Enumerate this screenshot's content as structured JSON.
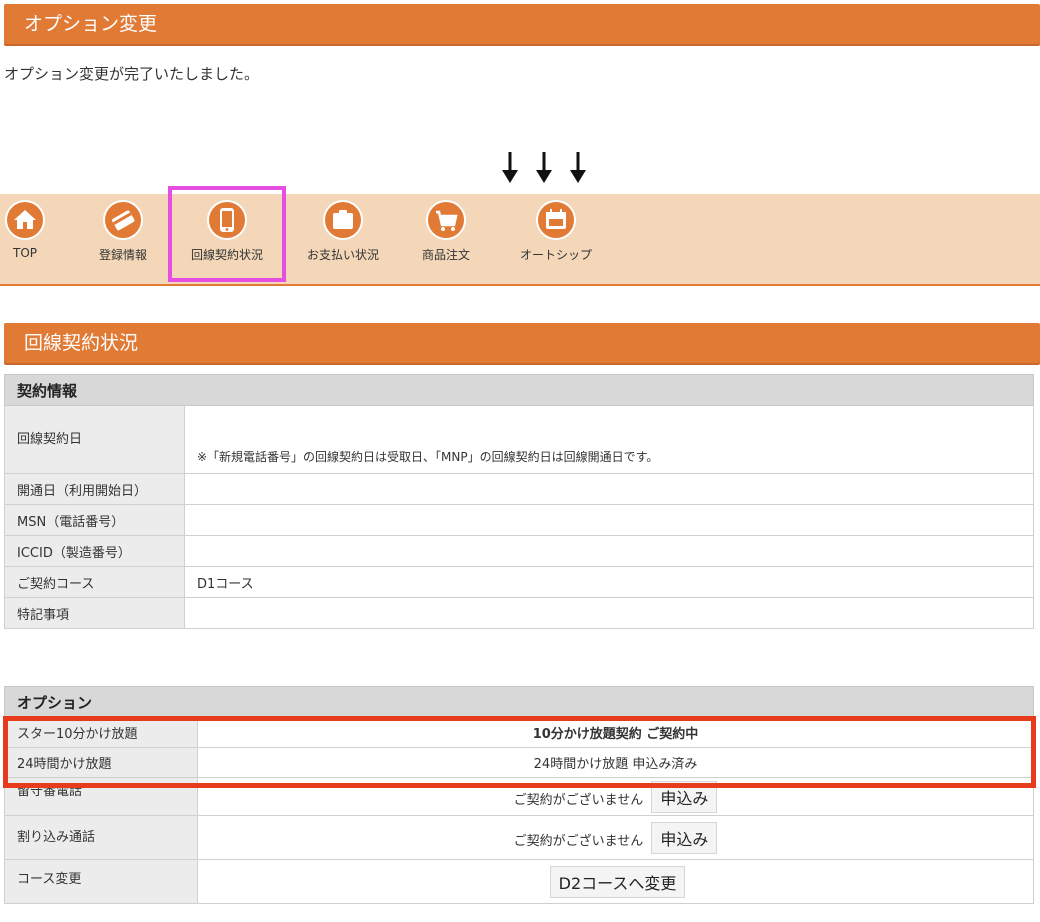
{
  "header": {
    "title": "オプション変更"
  },
  "message": "オプション変更が完了いたしました。",
  "nav": {
    "items": [
      {
        "label": "TOP",
        "icon": "home-icon"
      },
      {
        "label": "登録情報",
        "icon": "card-icon"
      },
      {
        "label": "回線契約状況",
        "icon": "smartphone-icon"
      },
      {
        "label": "お支払い状況",
        "icon": "wallet-icon"
      },
      {
        "label": "商品注文",
        "icon": "cart-icon"
      },
      {
        "label": "オートシップ",
        "icon": "calendar-icon"
      }
    ],
    "highlighted": "回線契約状況"
  },
  "line_section": {
    "title": "回線契約状況"
  },
  "contract": {
    "title": "契約情報",
    "rows": [
      {
        "label": "回線契約日",
        "value": "※「新規電話番号」の回線契約日は受取日、「MNP」の回線契約日は回線開通日です。"
      },
      {
        "label": "開通日（利用開始日）",
        "value": ""
      },
      {
        "label": "MSN（電話番号）",
        "value": ""
      },
      {
        "label": "ICCID（製造番号）",
        "value": ""
      },
      {
        "label": "ご契約コース",
        "value": "D1コース"
      },
      {
        "label": "特記事項",
        "value": ""
      }
    ]
  },
  "options": {
    "title": "オプション",
    "rows": [
      {
        "label": "スター10分かけ放題",
        "value": "10分かけ放題契約 ご契約中"
      },
      {
        "label": "24時間かけ放題",
        "value": "24時間かけ放題 申込み済み"
      },
      {
        "label": "留守番電話",
        "value": "ご契約がございません",
        "button": "申込み"
      },
      {
        "label": "割り込み通話",
        "value": "ご契約がございません",
        "button": "申込み"
      },
      {
        "label": "コース変更",
        "value": "",
        "button": "D2コースへ変更"
      }
    ]
  },
  "colors": {
    "accent": "#e07a35",
    "nav_bg": "#f3d7b8",
    "highlight": "#e64ee3",
    "alert": "#e63b1d"
  }
}
